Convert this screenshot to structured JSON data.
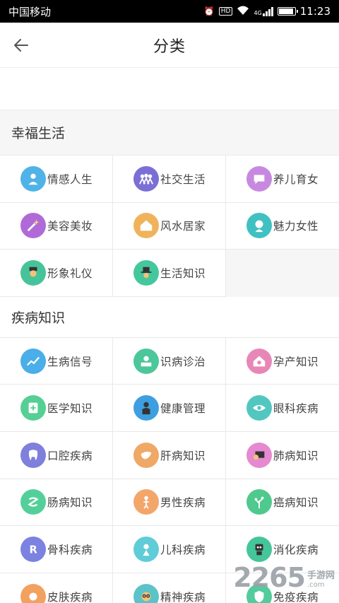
{
  "status_bar": {
    "carrier": "中国移动",
    "net": "4G",
    "time": "11:23"
  },
  "nav": {
    "title": "分类"
  },
  "sections": [
    {
      "title": "幸福生活",
      "items": [
        {
          "label": "情感人生",
          "icon": "heart-person-icon",
          "color": "#4fb3e8"
        },
        {
          "label": "社交生活",
          "icon": "group-people-icon",
          "color": "#7b6fd6"
        },
        {
          "label": "养儿育女",
          "icon": "chat-bubble-icon",
          "color": "#c789e0"
        },
        {
          "label": "美容美妆",
          "icon": "magic-wand-icon",
          "color": "#b06ad8"
        },
        {
          "label": "风水居家",
          "icon": "house-icon",
          "color": "#f0b35c"
        },
        {
          "label": "魅力女性",
          "icon": "woman-face-icon",
          "color": "#3fc1c1"
        },
        {
          "label": "形象礼仪",
          "icon": "gentleman-icon",
          "color": "#47c39a"
        },
        {
          "label": "生活知识",
          "icon": "hat-icon",
          "color": "#45c79e"
        }
      ]
    },
    {
      "title": "疾病知识",
      "items": [
        {
          "label": "生病信号",
          "icon": "chart-signal-icon",
          "color": "#4aaee9"
        },
        {
          "label": "识病诊治",
          "icon": "doctor-desk-icon",
          "color": "#4cc79a"
        },
        {
          "label": "孕产知识",
          "icon": "home-baby-icon",
          "color": "#e787b8"
        },
        {
          "label": "医学知识",
          "icon": "medical-book-icon",
          "color": "#55cf94"
        },
        {
          "label": "健康管理",
          "icon": "person-suit-icon",
          "color": "#3e9fe0"
        },
        {
          "label": "眼科疾病",
          "icon": "eye-icon",
          "color": "#52c7c0"
        },
        {
          "label": "口腔疾病",
          "icon": "tooth-icon",
          "color": "#7f7fdc"
        },
        {
          "label": "肝病知识",
          "icon": "liver-icon",
          "color": "#f0a866"
        },
        {
          "label": "肺病知识",
          "icon": "lungs-board-icon",
          "color": "#e58ad0"
        },
        {
          "label": "肠病知识",
          "icon": "intestine-icon",
          "color": "#55cf9a"
        },
        {
          "label": "男性疾病",
          "icon": "male-figure-icon",
          "color": "#f3a66a"
        },
        {
          "label": "癌病知识",
          "icon": "cell-tree-icon",
          "color": "#4fc98e"
        },
        {
          "label": "骨科疾病",
          "icon": "bone-r-icon",
          "color": "#7b82e0"
        },
        {
          "label": "儿科疾病",
          "icon": "child-icon",
          "color": "#60ccd8"
        },
        {
          "label": "消化疾病",
          "icon": "stomach-robot-icon",
          "color": "#45c59a"
        },
        {
          "label": "皮肤疾病",
          "icon": "skin-icon",
          "color": "#f2a25e"
        },
        {
          "label": "精神疾病",
          "icon": "glasses-face-icon",
          "color": "#5cc3c9"
        },
        {
          "label": "免疫疾病",
          "icon": "shield-virus-icon",
          "color": "#52cc9c"
        }
      ]
    }
  ],
  "watermark": {
    "number": "2265",
    "cn": "手游网",
    "domain": ".com"
  }
}
